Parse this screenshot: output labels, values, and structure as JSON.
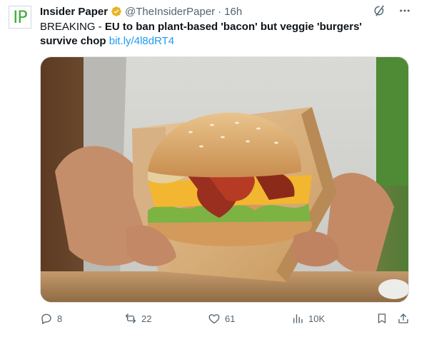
{
  "author": {
    "avatar_text": "IP",
    "display_name": "Insider Paper",
    "handle": "@TheInsiderPaper",
    "separator": "·",
    "time": "16h",
    "verified_color": "#e8b321"
  },
  "tweet": {
    "prefix": "BREAKING - ",
    "headline": "EU to ban plant-based 'bacon' but veggie 'burgers' survive chop",
    "link": "bit.ly/4l8dRT4"
  },
  "media": {
    "description": "photo-burger-in-paper-wrap"
  },
  "actions": {
    "replies": "8",
    "reposts": "22",
    "likes": "61",
    "views": "10K"
  },
  "colors": {
    "accent_link": "#1d9bf0",
    "muted": "#536471",
    "brand_green": "#3fae3a"
  }
}
